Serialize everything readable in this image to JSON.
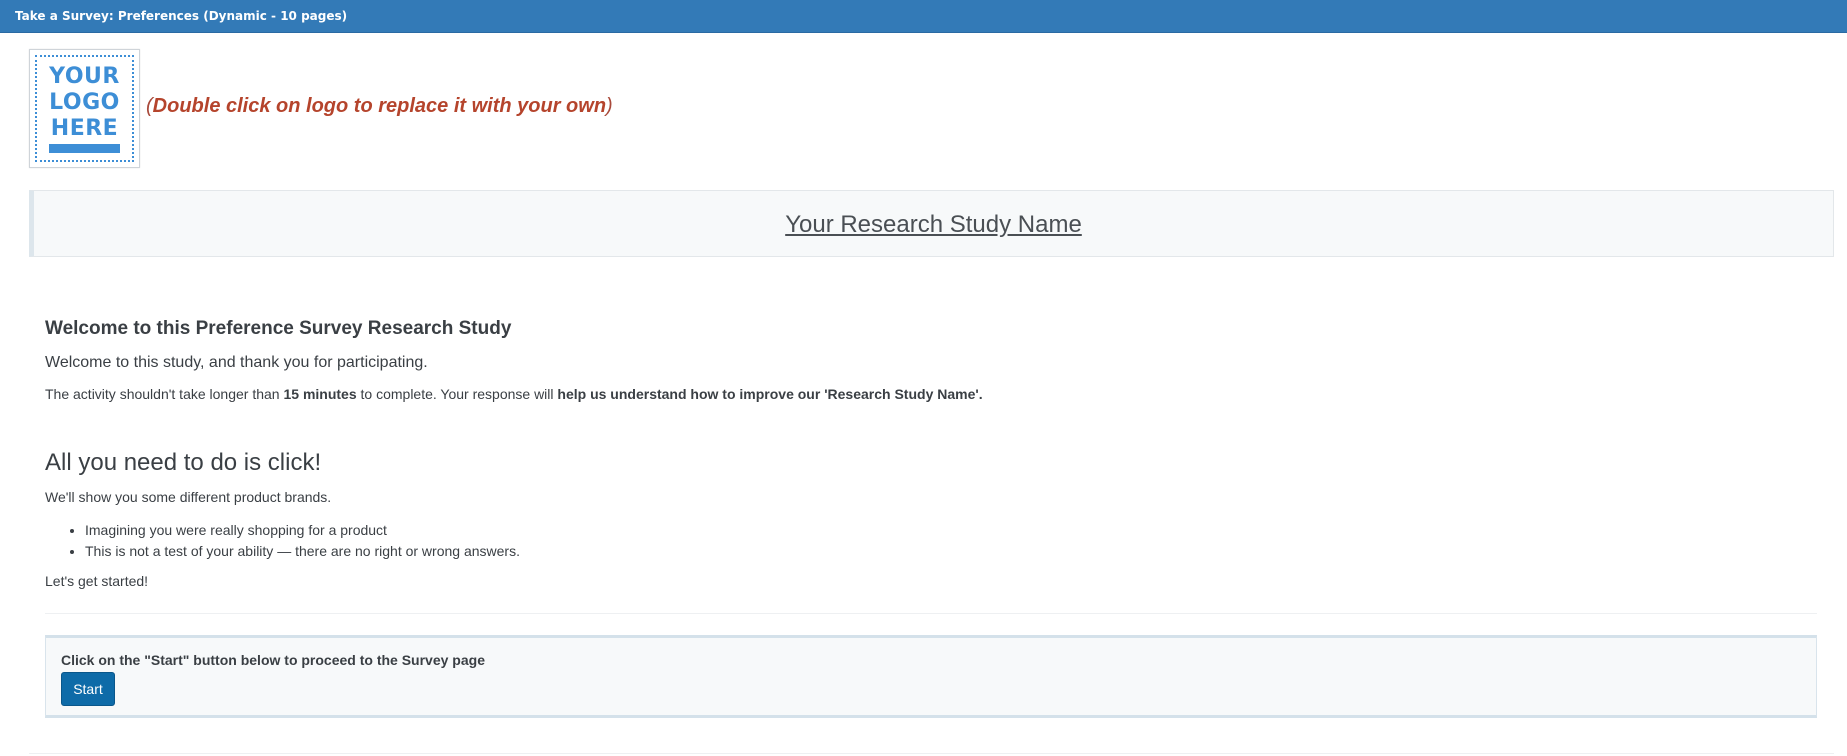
{
  "titlebar": {
    "title": "Take a Survey: Preferences (Dynamic - 10 pages)"
  },
  "logo": {
    "line1": "YOUR",
    "line2": "LOGO",
    "line3": "HERE",
    "hint_open": "(",
    "hint_text": "Double click on logo to replace it with your own",
    "hint_close": ")",
    "accent_color": "#3d8ed6"
  },
  "banner": {
    "study_name": "Your Research Study Name"
  },
  "intro": {
    "heading": "Welcome to this Preference Survey Research Study",
    "lead": "Welcome to this study, and thank you for participating.",
    "activity_prefix": "The activity shouldn't take longer than ",
    "activity_duration": "15 minutes",
    "activity_middle": " to complete. Your response will ",
    "activity_purpose": "help us understand how to improve our 'Research Study Name'."
  },
  "instructions": {
    "heading": "All you need to do is click!",
    "brands_line": "We'll show you some different product brands.",
    "bullets": [
      "Imagining you were really shopping for a product",
      "This is not a test of your ability — there are no right or wrong answers."
    ],
    "closing": "Let's get started!"
  },
  "start_panel": {
    "instruction": "Click on the \"Start\" button below to proceed to the Survey page",
    "button_label": "Start"
  },
  "colors": {
    "titlebar": "#337ab7",
    "hint": "#b5442c",
    "button": "#0e6ba8"
  }
}
